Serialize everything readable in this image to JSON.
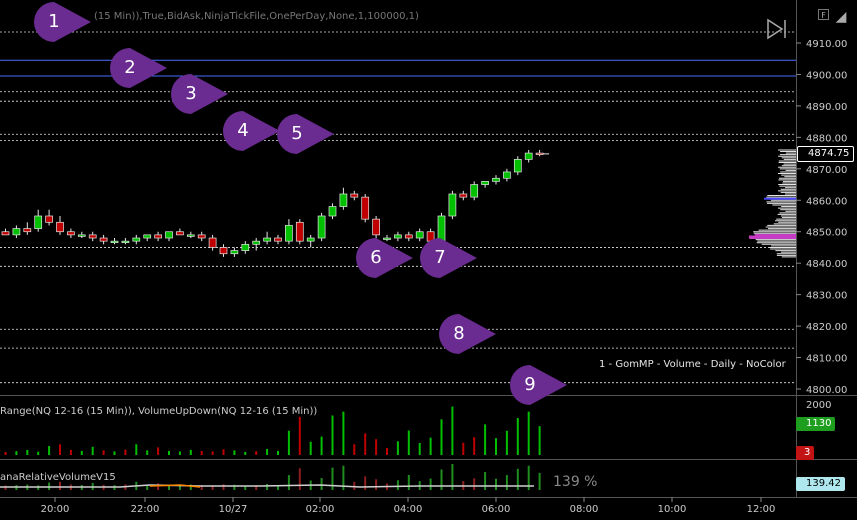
{
  "header": {
    "main_series_params": "(15 Min)),True,BidAsk,NinjaTickFile,OnePerDay,None,1,100000,1)",
    "f_button_label": "F",
    "corner_arrow_label": "◢"
  },
  "price_axis": {
    "ticks": [
      "4910.00",
      "4900.00",
      "4890.00",
      "4880.00",
      "4870.00",
      "4860.00",
      "4850.00",
      "4840.00",
      "4830.00",
      "4820.00",
      "4810.00",
      "4800.00"
    ],
    "last_price": "4874.75"
  },
  "time_axis": {
    "ticks": [
      "20:00",
      "22:00",
      "10/27",
      "02:00",
      "04:00",
      "06:00",
      "08:00",
      "10:00",
      "12:00"
    ]
  },
  "volume_panel": {
    "title": "Range(NQ 12-16 (15 Min)), VolumeUpDown(NQ 12-16 (15 Min))",
    "axis_label": "2000",
    "badge_value": "1130",
    "small_badge": "3"
  },
  "relvol_panel": {
    "title": "anaRelativeVolumeV15",
    "percent_label": "139 %",
    "badge_value": "139.42"
  },
  "legend": {
    "text": "1 - GomMP - Volume - Daily - NoColor"
  },
  "callouts": [
    "1",
    "2",
    "3",
    "4",
    "5",
    "6",
    "7",
    "8",
    "9"
  ],
  "colors": {
    "background": "#000000",
    "up_candle": "#00c000",
    "down_candle": "#c00000",
    "callout": "#6a2c91",
    "level_line": "#e6e6e6",
    "blue_line": "#4a6cff"
  },
  "chart_data": {
    "type": "candlestick",
    "price_unit": "NQ 12-16 index points",
    "ylim": [
      4800,
      4915
    ],
    "levels_solid_blue": [
      4904.5,
      4899.5
    ],
    "levels_dashed_white": [
      4913.5,
      4894.5,
      4891.5,
      4881,
      4879,
      4845,
      4839,
      4819,
      4813,
      4802
    ],
    "candles": [
      {
        "o": 4850,
        "h": 4851,
        "l": 4849,
        "c": 4849
      },
      {
        "o": 4849,
        "h": 4852,
        "l": 4848,
        "c": 4851
      },
      {
        "o": 4851,
        "h": 4853,
        "l": 4849,
        "c": 4850
      },
      {
        "o": 4851,
        "h": 4857,
        "l": 4850,
        "c": 4855
      },
      {
        "o": 4855,
        "h": 4857,
        "l": 4852,
        "c": 4853
      },
      {
        "o": 4853,
        "h": 4855,
        "l": 4849,
        "c": 4850
      },
      {
        "o": 4850,
        "h": 4851,
        "l": 4848,
        "c": 4849
      },
      {
        "o": 4849,
        "h": 4850,
        "l": 4848,
        "c": 4849
      },
      {
        "o": 4849,
        "h": 4850,
        "l": 4847,
        "c": 4848
      },
      {
        "o": 4848,
        "h": 4849,
        "l": 4846,
        "c": 4847
      },
      {
        "o": 4847,
        "h": 4848,
        "l": 4846,
        "c": 4847
      },
      {
        "o": 4847,
        "h": 4848,
        "l": 4846,
        "c": 4847
      },
      {
        "o": 4847,
        "h": 4849,
        "l": 4846,
        "c": 4848
      },
      {
        "o": 4848,
        "h": 4849,
        "l": 4847,
        "c": 4849
      },
      {
        "o": 4849,
        "h": 4850,
        "l": 4847,
        "c": 4848
      },
      {
        "o": 4848,
        "h": 4850,
        "l": 4847,
        "c": 4850
      },
      {
        "o": 4850,
        "h": 4851,
        "l": 4849,
        "c": 4849
      },
      {
        "o": 4849,
        "h": 4850,
        "l": 4848,
        "c": 4849
      },
      {
        "o": 4849,
        "h": 4850,
        "l": 4847,
        "c": 4848
      },
      {
        "o": 4848,
        "h": 4849,
        "l": 4844,
        "c": 4845
      },
      {
        "o": 4845,
        "h": 4846,
        "l": 4842,
        "c": 4843
      },
      {
        "o": 4843,
        "h": 4845,
        "l": 4842,
        "c": 4844
      },
      {
        "o": 4844,
        "h": 4847,
        "l": 4843,
        "c": 4846
      },
      {
        "o": 4846,
        "h": 4848,
        "l": 4844,
        "c": 4847
      },
      {
        "o": 4847,
        "h": 4850,
        "l": 4846,
        "c": 4848
      },
      {
        "o": 4848,
        "h": 4849,
        "l": 4846,
        "c": 4847
      },
      {
        "o": 4847,
        "h": 4854,
        "l": 4846,
        "c": 4852
      },
      {
        "o": 4853,
        "h": 4854,
        "l": 4846,
        "c": 4847
      },
      {
        "o": 4847,
        "h": 4849,
        "l": 4845,
        "c": 4848
      },
      {
        "o": 4848,
        "h": 4856,
        "l": 4847,
        "c": 4855
      },
      {
        "o": 4855,
        "h": 4859,
        "l": 4854,
        "c": 4858
      },
      {
        "o": 4858,
        "h": 4864,
        "l": 4857,
        "c": 4862
      },
      {
        "o": 4862,
        "h": 4863,
        "l": 4860,
        "c": 4861
      },
      {
        "o": 4861,
        "h": 4862,
        "l": 4853,
        "c": 4854
      },
      {
        "o": 4854,
        "h": 4855,
        "l": 4847,
        "c": 4849
      },
      {
        "o": 4848,
        "h": 4849,
        "l": 4847,
        "c": 4848
      },
      {
        "o": 4848,
        "h": 4850,
        "l": 4847,
        "c": 4849
      },
      {
        "o": 4849,
        "h": 4850,
        "l": 4847,
        "c": 4848
      },
      {
        "o": 4848,
        "h": 4851,
        "l": 4847,
        "c": 4850
      },
      {
        "o": 4850,
        "h": 4851,
        "l": 4846,
        "c": 4847
      },
      {
        "o": 4847,
        "h": 4856,
        "l": 4846,
        "c": 4855
      },
      {
        "o": 4855,
        "h": 4863,
        "l": 4854,
        "c": 4862
      },
      {
        "o": 4862,
        "h": 4863,
        "l": 4860,
        "c": 4861
      },
      {
        "o": 4861,
        "h": 4866,
        "l": 4860,
        "c": 4865
      },
      {
        "o": 4865,
        "h": 4866,
        "l": 4864,
        "c": 4866
      },
      {
        "o": 4866,
        "h": 4868,
        "l": 4865,
        "c": 4867
      },
      {
        "o": 4867,
        "h": 4870,
        "l": 4866,
        "c": 4869
      },
      {
        "o": 4869,
        "h": 4874,
        "l": 4868,
        "c": 4873
      },
      {
        "o": 4873,
        "h": 4876,
        "l": 4872,
        "c": 4875
      },
      {
        "o": 4875,
        "h": 4876,
        "l": 4874,
        "c": 4874.75
      }
    ],
    "volume": {
      "ylim": [
        0,
        2000
      ],
      "bars": [
        {
          "v": 120,
          "d": "down"
        },
        {
          "v": 150,
          "d": "up"
        },
        {
          "v": 200,
          "d": "up"
        },
        {
          "v": 130,
          "d": "up"
        },
        {
          "v": 350,
          "d": "up"
        },
        {
          "v": 420,
          "d": "down"
        },
        {
          "v": 200,
          "d": "down"
        },
        {
          "v": 160,
          "d": "up"
        },
        {
          "v": 320,
          "d": "up"
        },
        {
          "v": 180,
          "d": "down"
        },
        {
          "v": 140,
          "d": "up"
        },
        {
          "v": 210,
          "d": "down"
        },
        {
          "v": 420,
          "d": "up"
        },
        {
          "v": 180,
          "d": "up"
        },
        {
          "v": 300,
          "d": "down"
        },
        {
          "v": 160,
          "d": "up"
        },
        {
          "v": 140,
          "d": "up"
        },
        {
          "v": 200,
          "d": "up"
        },
        {
          "v": 160,
          "d": "down"
        },
        {
          "v": 140,
          "d": "down"
        },
        {
          "v": 220,
          "d": "down"
        },
        {
          "v": 180,
          "d": "up"
        },
        {
          "v": 120,
          "d": "up"
        },
        {
          "v": 150,
          "d": "down"
        },
        {
          "v": 240,
          "d": "up"
        },
        {
          "v": 160,
          "d": "up"
        },
        {
          "v": 950,
          "d": "up"
        },
        {
          "v": 1500,
          "d": "down"
        },
        {
          "v": 520,
          "d": "up"
        },
        {
          "v": 720,
          "d": "up"
        },
        {
          "v": 1550,
          "d": "up"
        },
        {
          "v": 1700,
          "d": "up"
        },
        {
          "v": 420,
          "d": "down"
        },
        {
          "v": 850,
          "d": "down"
        },
        {
          "v": 620,
          "d": "down"
        },
        {
          "v": 280,
          "d": "down"
        },
        {
          "v": 540,
          "d": "up"
        },
        {
          "v": 960,
          "d": "up"
        },
        {
          "v": 470,
          "d": "up"
        },
        {
          "v": 680,
          "d": "up"
        },
        {
          "v": 1400,
          "d": "up"
        },
        {
          "v": 1900,
          "d": "up"
        },
        {
          "v": 480,
          "d": "down"
        },
        {
          "v": 700,
          "d": "down"
        },
        {
          "v": 1200,
          "d": "up"
        },
        {
          "v": 660,
          "d": "up"
        },
        {
          "v": 950,
          "d": "up"
        },
        {
          "v": 1450,
          "d": "up"
        },
        {
          "v": 1700,
          "d": "up"
        },
        {
          "v": 1130,
          "d": "up"
        }
      ]
    },
    "relative_volume": {
      "last_value": 139.42
    }
  }
}
